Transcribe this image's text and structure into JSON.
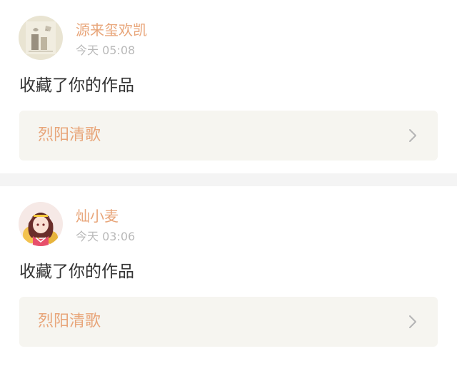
{
  "notifications": [
    {
      "username": "源来玺欢凯",
      "time": "今天 05:08",
      "action": "收藏了你的作品",
      "work_title": "烈阳清歌",
      "avatar_icon": "sketch-avatar-icon"
    },
    {
      "username": "灿小麦",
      "time": "今天 03:06",
      "action": "收藏了你的作品",
      "work_title": "烈阳清歌",
      "avatar_icon": "anime-girl-avatar-icon"
    }
  ],
  "colors": {
    "accent": "#e8a579",
    "muted": "#b9b9b9",
    "text": "#333333",
    "box_bg": "#f6f5f0",
    "divider": "#f4f4f4"
  }
}
